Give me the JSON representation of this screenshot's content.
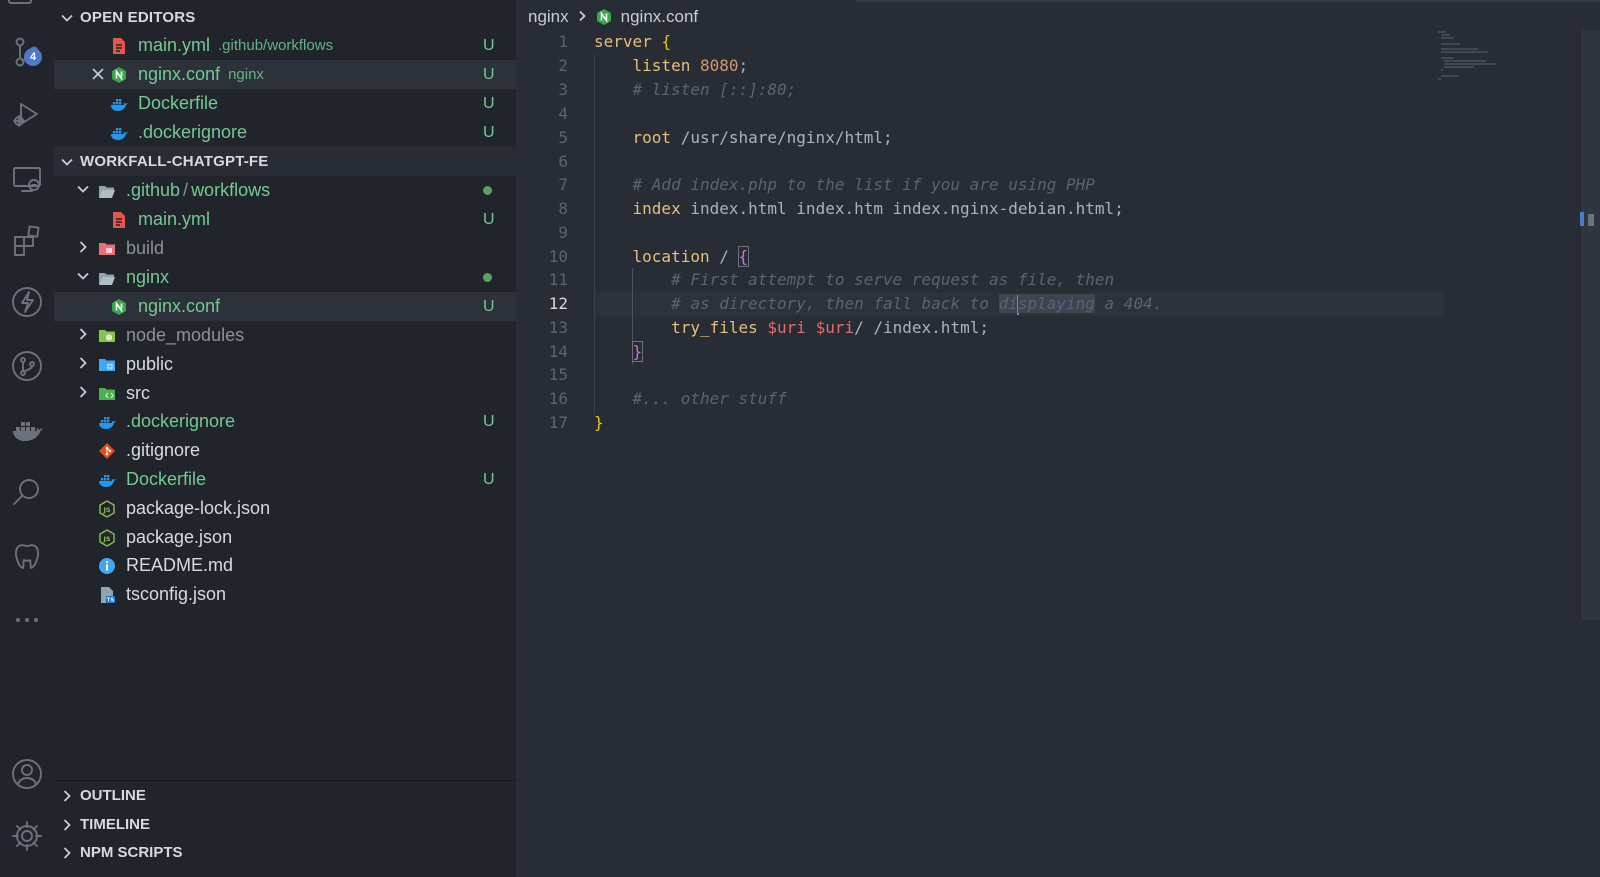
{
  "activity_bar": {
    "source_control_badge": "4",
    "icons": [
      "explorer-icon",
      "source-control-icon",
      "run-debug-icon",
      "remote-explorer-icon",
      "extensions-icon",
      "lightning-icon",
      "git-graph-icon",
      "docker-icon",
      "search-icon",
      "database-icon",
      "more-icon",
      "account-icon",
      "settings-gear-icon"
    ]
  },
  "sidebar": {
    "open_editors": {
      "title": "OPEN EDITORS",
      "items": [
        {
          "name": "main.yml",
          "desc": ".github/workflows",
          "status": "U"
        },
        {
          "name": "nginx.conf",
          "desc": "nginx",
          "status": "U"
        },
        {
          "name": "Dockerfile",
          "desc": "",
          "status": "U"
        },
        {
          "name": ".dockerignore",
          "desc": "",
          "status": "U"
        }
      ]
    },
    "explorer": {
      "title": "WORKFALL-CHATGPT-FE",
      "github_folder": {
        "part1": ".github",
        "sep": "/",
        "part2": "workflows"
      },
      "items": [
        {
          "name": "main.yml",
          "status": "U"
        },
        {
          "name": "build",
          "status": ""
        },
        {
          "name": "nginx",
          "status": ""
        },
        {
          "name": "nginx.conf",
          "status": "U"
        },
        {
          "name": "node_modules",
          "status": ""
        },
        {
          "name": "public",
          "status": ""
        },
        {
          "name": "src",
          "status": ""
        },
        {
          "name": ".dockerignore",
          "status": "U"
        },
        {
          "name": ".gitignore",
          "status": ""
        },
        {
          "name": "Dockerfile",
          "status": "U"
        },
        {
          "name": "package-lock.json",
          "status": ""
        },
        {
          "name": "package.json",
          "status": ""
        },
        {
          "name": "README.md",
          "status": ""
        },
        {
          "name": "tsconfig.json",
          "status": ""
        }
      ]
    },
    "bottom_sections": [
      "OUTLINE",
      "TIMELINE",
      "NPM SCRIPTS"
    ]
  },
  "editor": {
    "breadcrumb": {
      "folder": "nginx",
      "file": "nginx.conf"
    },
    "line_numbers": [
      "1",
      "2",
      "3",
      "4",
      "5",
      "6",
      "7",
      "8",
      "9",
      "10",
      "11",
      "12",
      "13",
      "14",
      "15",
      "16",
      "17"
    ],
    "current_line": "12",
    "code": {
      "l1_kw": "server",
      "l1_brace": "{",
      "l2_kw": "listen",
      "l2_num": "8080",
      "l2_semi": ";",
      "l3": "# listen [::]:80;",
      "l5_kw": "root",
      "l5_val": " /usr/share/nginx/html",
      "l5_semi": ";",
      "l7": "# Add index.php to the list if you are using PHP",
      "l8_kw": "index",
      "l8_val": " index.html index.htm index.nginx-debian.html",
      "l8_semi": ";",
      "l10_kw": "location",
      "l10_val": " / ",
      "l10_brace": "{",
      "l11": "# First attempt to serve request as file, then",
      "l12_a": "# as directory, then fall back to ",
      "l12_sel1": "di",
      "l12_sel2": "splaying",
      "l12_b": " a 404.",
      "l13_kw": "try_files",
      "l13_v1": " $uri",
      "l13_v2": " $uri",
      "l13_rest": "/ /index.html",
      "l13_semi": ";",
      "l14_brace": "}",
      "l16": "#... other stuff",
      "l17_brace": "}"
    }
  }
}
